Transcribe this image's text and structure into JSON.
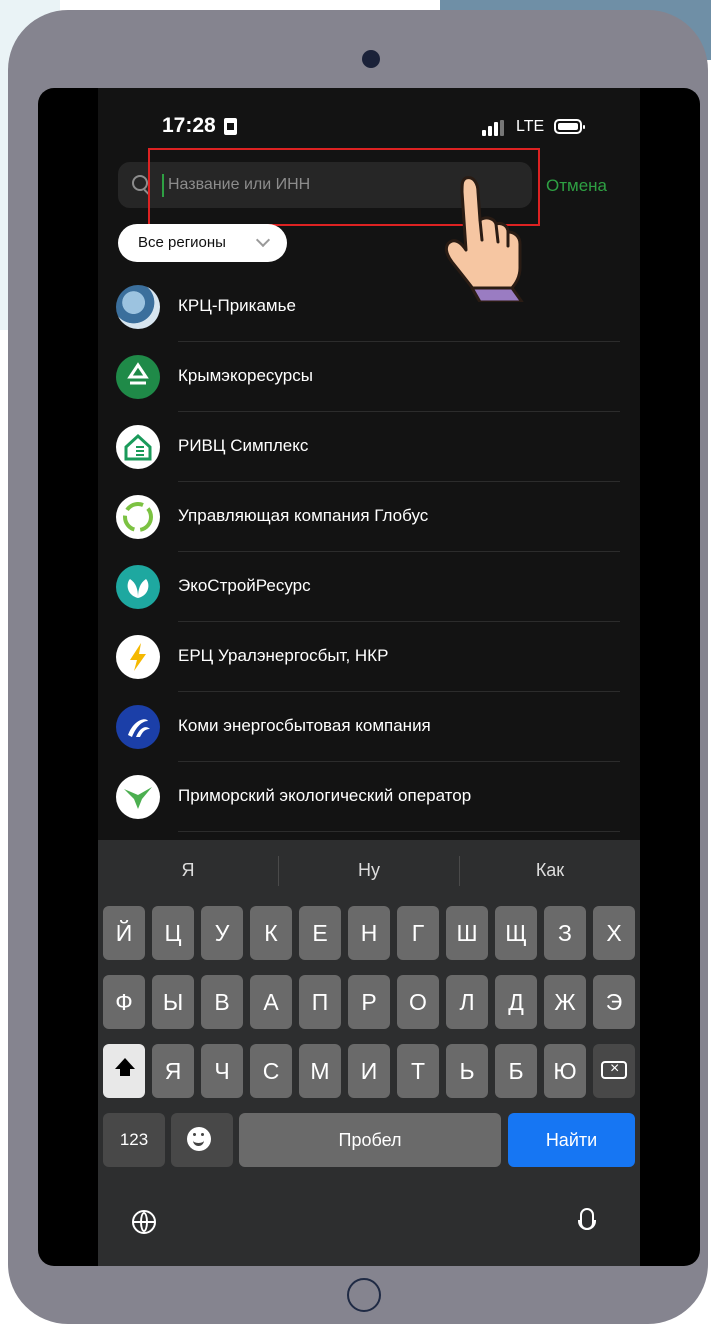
{
  "status_bar": {
    "time": "17:28",
    "network": "LTE",
    "icons": [
      "sim-card-icon",
      "signal-icon",
      "battery-icon"
    ]
  },
  "search": {
    "placeholder": "Название или ИНН",
    "cancel_label": "Отмена",
    "icon": "search-icon"
  },
  "filter": {
    "region_label": "Все регионы",
    "icon": "chevron-down-icon"
  },
  "organizations": [
    {
      "label": "КРЦ-Прикамье",
      "logo": "krc-logo-icon"
    },
    {
      "label": "Крымэкоресурсы",
      "logo": "recycle-logo-icon"
    },
    {
      "label": "РИВЦ Симплекс",
      "logo": "house-logo-icon"
    },
    {
      "label": "Управляющая компания Глобус",
      "logo": "recycle-leaf-logo-icon"
    },
    {
      "label": "ЭкоСтройРесурс",
      "logo": "leaf-logo-icon"
    },
    {
      "label": "ЕРЦ Уралэнергосбыт, НКР",
      "logo": "lightning-logo-icon"
    },
    {
      "label": "Коми энергосбытовая компания",
      "logo": "komi-logo-icon"
    },
    {
      "label": "Приморский экологический оператор",
      "logo": "bird-logo-icon"
    }
  ],
  "keyboard": {
    "suggestions": [
      "Я",
      "Ну",
      "Как"
    ],
    "row1": [
      "Й",
      "Ц",
      "У",
      "К",
      "Е",
      "Н",
      "Г",
      "Ш",
      "Щ",
      "З",
      "Х"
    ],
    "row2": [
      "Ф",
      "Ы",
      "В",
      "А",
      "П",
      "Р",
      "О",
      "Л",
      "Д",
      "Ж",
      "Э"
    ],
    "row3": [
      "Я",
      "Ч",
      "С",
      "М",
      "И",
      "Т",
      "Ь",
      "Б",
      "Ю"
    ],
    "numbers_label": "123",
    "space_label": "Пробел",
    "search_label": "Найти"
  },
  "colors": {
    "accent": "#2ea043",
    "highlight": "#dd2222",
    "search_key": "#1676f3",
    "device": "#85848f"
  }
}
